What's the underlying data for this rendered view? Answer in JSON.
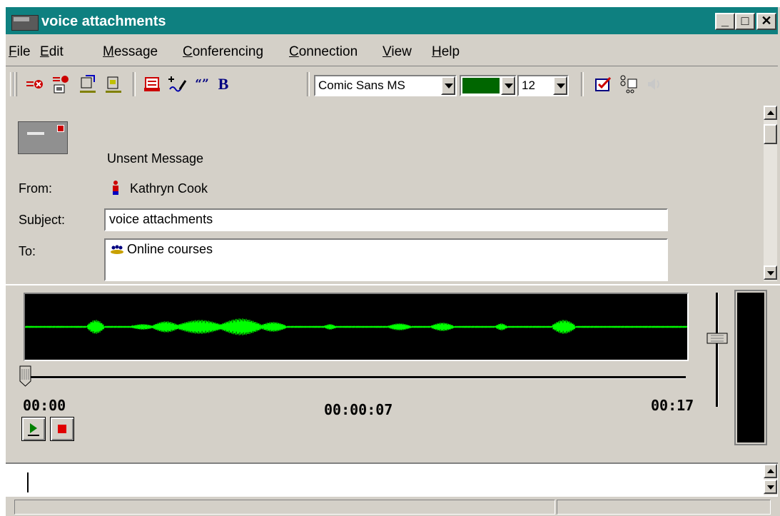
{
  "window": {
    "title": "voice attachments",
    "controls": {
      "minimize": "_",
      "maximize": "□",
      "close": "✕"
    }
  },
  "menu": [
    "File",
    "Edit",
    "Message",
    "Conferencing",
    "Connection",
    "View",
    "Help"
  ],
  "toolbar": {
    "font_name": "Comic Sans MS",
    "font_color": "#006600",
    "font_size": "12",
    "quote_glyph": "“”",
    "bold_glyph": "B"
  },
  "message": {
    "status": "Unsent Message",
    "from_label": "From:",
    "from_value": "Kathryn Cook",
    "subject_label": "Subject:",
    "subject_value": "voice attachments",
    "to_label": "To:",
    "to_value": "Online courses"
  },
  "audio": {
    "start_time": "00:00",
    "current_time": "00:00:07",
    "end_time": "00:17",
    "playhead_fraction": 0.0,
    "volume_fraction": 0.6,
    "waveform_color": "#00ff00"
  },
  "colors": {
    "titlebar": "#0e8080",
    "chrome": "#d4d0c8"
  }
}
